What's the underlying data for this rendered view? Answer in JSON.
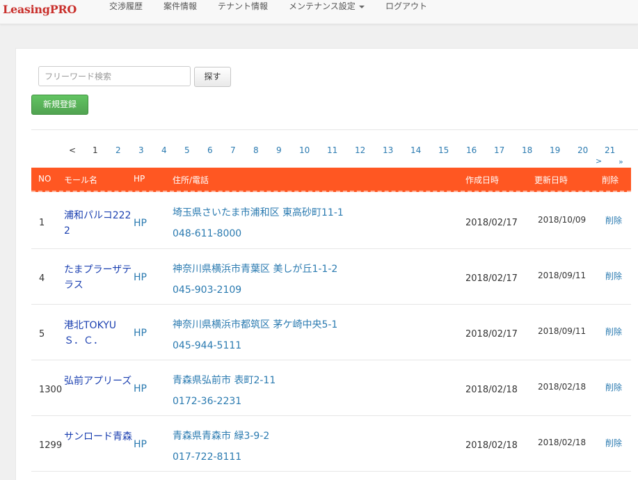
{
  "app": {
    "brand": "LeasingPRO"
  },
  "nav": {
    "items": [
      {
        "label": "交渉履歴"
      },
      {
        "label": "案件情報"
      },
      {
        "label": "テナント情報"
      },
      {
        "label": "メンテナンス設定"
      },
      {
        "label": "ログアウト"
      }
    ]
  },
  "search": {
    "placeholder": "フリーワード検索",
    "value": "",
    "button_label": "探す"
  },
  "actions": {
    "new_label": "新規登録"
  },
  "pagination": {
    "prev": "<",
    "current": "1",
    "pages": [
      "1",
      "2",
      "3",
      "4",
      "5",
      "6",
      "7",
      "8",
      "9",
      "10",
      "11",
      "12",
      "13",
      "14",
      "15",
      "16",
      "17",
      "18",
      "19",
      "20",
      "21"
    ],
    "next": ">",
    "last": "»"
  },
  "table": {
    "header_color": "#ff5722",
    "columns": {
      "no": "NO",
      "name": "モール名",
      "hp": "HP",
      "address": "住所/電話",
      "created": "作成日時",
      "updated": "更新日時",
      "delete": "削除"
    },
    "rows": [
      {
        "no": "1",
        "name": "浦和パルコ2222",
        "hp": "HP",
        "address": "埼玉県さいたま市浦和区 東高砂町11-1",
        "tel": "048-611-8000",
        "created": "2018/02/17",
        "updated": "2018/10/09",
        "delete": "削除"
      },
      {
        "no": "4",
        "name": "たまプラーザテラス",
        "hp": "HP",
        "address": "神奈川県横浜市青葉区 美しが丘1-1-2",
        "tel": "045-903-2109",
        "created": "2018/02/17",
        "updated": "2018/09/11",
        "delete": "削除"
      },
      {
        "no": "5",
        "name": "港北TOKYU Ｓ．Ｃ．",
        "hp": "HP",
        "address": "神奈川県横浜市都筑区 茅ケ崎中央5-1",
        "tel": "045-944-5111",
        "created": "2018/02/17",
        "updated": "2018/09/11",
        "delete": "削除"
      },
      {
        "no": "1300",
        "name": "弘前アプリーズ",
        "hp": "HP",
        "address": "青森県弘前市 表町2-11",
        "tel": "0172-36-2231",
        "created": "2018/02/18",
        "updated": "2018/02/18",
        "delete": "削除"
      },
      {
        "no": "1299",
        "name": "サンロード青森",
        "hp": "HP",
        "address": "青森県青森市 緑3-9-2",
        "tel": "017-722-8111",
        "created": "2018/02/18",
        "updated": "2018/02/18",
        "delete": "削除"
      }
    ]
  }
}
